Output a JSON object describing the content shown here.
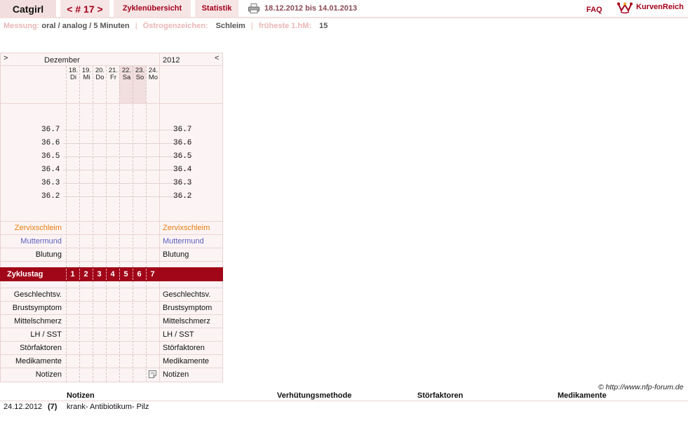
{
  "nav": {
    "user": "Catgirl",
    "cycle": "< # 17 >",
    "overview": "Zyklenübersicht",
    "stats": "Statistik",
    "date_range": "18.12.2012 bis 14.01.2013",
    "faq": "FAQ",
    "brand": "KurvenReich",
    "print_icon": "printer-icon",
    "logo_icon": "crown-icon"
  },
  "settings": {
    "measure_label": "Messung:",
    "measure_value": "oral / analog / 5 Minuten",
    "estrogen_label": "Östrogenzeichen:",
    "estrogen_value": "Schleim",
    "earliest_label": "früheste 1.hM:",
    "earliest_value": "15"
  },
  "chart": {
    "prev": ">",
    "next": "<",
    "month": "Dezember",
    "year": "2012",
    "days": [
      {
        "num": "18.",
        "wd": "Di"
      },
      {
        "num": "19.",
        "wd": "Mi"
      },
      {
        "num": "20.",
        "wd": "Do"
      },
      {
        "num": "21.",
        "wd": "Fr"
      },
      {
        "num": "22.",
        "wd": "Sa"
      },
      {
        "num": "23.",
        "wd": "So"
      },
      {
        "num": "24.",
        "wd": "Mo"
      }
    ],
    "temps": [
      "36.7",
      "36.6",
      "36.5",
      "36.4",
      "36.3",
      "36.2"
    ],
    "rows_top": [
      "Zervixschleim",
      "Muttermund",
      "Blutung"
    ],
    "zyklus_label": "Zyklustag",
    "zyklus_days": [
      "1",
      "2",
      "3",
      "4",
      "5",
      "6",
      "7"
    ],
    "rows_bottom": [
      "Geschlechtsv.",
      "Brustsymptom",
      "Mittelschmerz",
      "LH / SST",
      "Störfaktoren",
      "Medikamente",
      "Notizen"
    ],
    "note_icon": "note-icon",
    "colors": {
      "accent": "#a10518",
      "cervix": "#e87d0f",
      "cervix_os": "#5a5fc0"
    }
  },
  "footer": {
    "copyright": "© http://www.nfp-forum.de",
    "headers": [
      "Notizen",
      "Verhütungsmethode",
      "Störfaktoren",
      "Medikamente"
    ],
    "row": {
      "date": "24.12.2012",
      "day": "(7)",
      "note": "krank- Antibiotikum- Pilz"
    }
  }
}
